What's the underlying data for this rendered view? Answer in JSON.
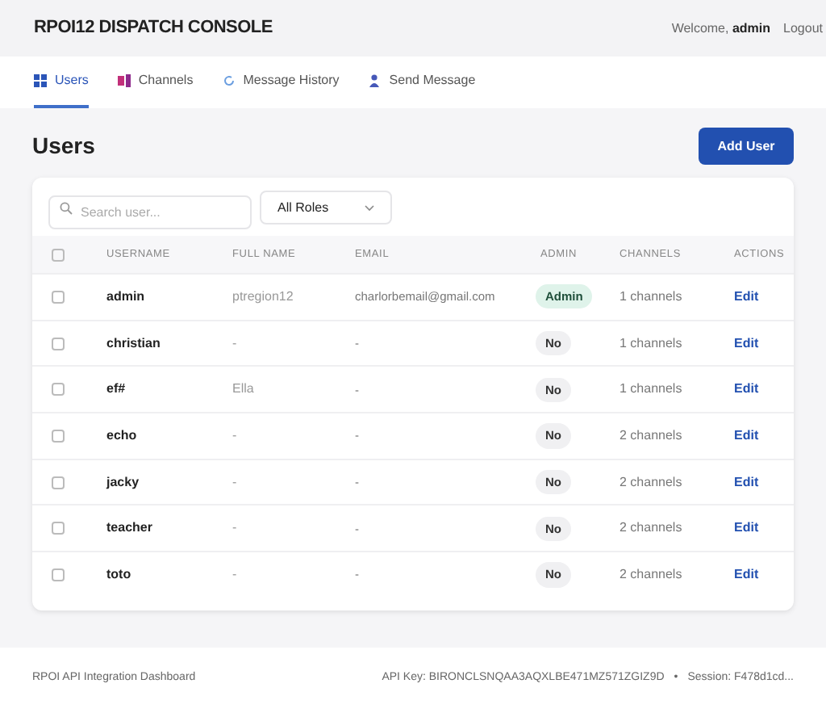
{
  "header": {
    "title": "RPOI12 DISPATCH CONSOLE",
    "welcome": "Welcome,",
    "user": "admin",
    "logout": "Logout"
  },
  "tabs": [
    {
      "label": "Users",
      "kind": "grid",
      "selected": true
    },
    {
      "label": "Channels",
      "kind": "channels",
      "selected": false
    },
    {
      "label": "Message History",
      "kind": "history",
      "selected": false
    },
    {
      "label": "Send Message",
      "kind": "person",
      "selected": false
    }
  ],
  "page": {
    "title": "Users",
    "add_button": "Add User"
  },
  "search": {
    "placeholder": "Search user..."
  },
  "role_filter": {
    "value": "All Roles"
  },
  "table": {
    "select_all_checked": false,
    "columns": [
      "USERNAME",
      "FULL NAME",
      "EMAIL",
      "ADMIN",
      "CHANNELS",
      "ACTIONS"
    ],
    "rows": [
      {
        "checked": false,
        "username": "admin",
        "full_name": "ptregion12",
        "email": "charlorbemail@gmail.com",
        "admin": true,
        "admin_label": "Admin",
        "channels": "1 channels",
        "action": "Edit"
      },
      {
        "checked": false,
        "username": "christian",
        "full_name": "-",
        "email": "-",
        "admin": false,
        "admin_label": "No",
        "channels": "1 channels",
        "action": "Edit"
      },
      {
        "checked": false,
        "username": "ef#",
        "full_name": "Ella",
        "email": "-",
        "admin": false,
        "admin_label": "No",
        "channels": "1 channels",
        "action": "Edit"
      },
      {
        "checked": false,
        "username": "echo",
        "full_name": "-",
        "email": "-",
        "admin": false,
        "admin_label": "No",
        "channels": "2 channels",
        "action": "Edit"
      },
      {
        "checked": false,
        "username": "jacky",
        "full_name": "-",
        "email": "-",
        "admin": false,
        "admin_label": "No",
        "channels": "2 channels",
        "action": "Edit"
      },
      {
        "checked": false,
        "username": "teacher",
        "full_name": "-",
        "email": "-",
        "admin": false,
        "admin_label": "No",
        "channels": "2 channels",
        "action": "Edit"
      },
      {
        "checked": false,
        "username": "toto",
        "full_name": "-",
        "email": "-",
        "admin": false,
        "admin_label": "No",
        "channels": "2 channels",
        "action": "Edit"
      }
    ]
  },
  "footer": {
    "left": "RPOI API Integration Dashboard",
    "api_key": "API Key: BIRONCLSNQAA3AQXLBE471MZ571ZGIZ9D",
    "separator": "•",
    "session": "Session: F478d1cd..."
  }
}
